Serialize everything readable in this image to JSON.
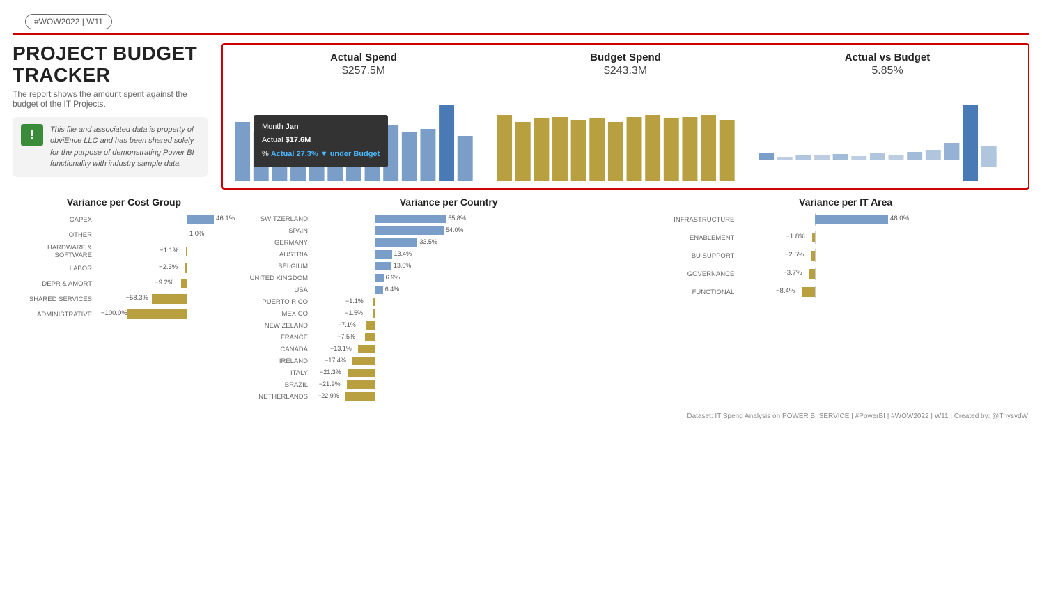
{
  "header": {
    "tag": "#WOW2022 | W11"
  },
  "project": {
    "title": "PROJECT BUDGET TRACKER",
    "subtitle": "The report shows the amount spent against the budget of the IT Projects.",
    "notice": "This file and associated data is property of obviEnce LLC and has been shared solely for the purpose of demonstrating Power BI functionality with industry sample data."
  },
  "kpi": {
    "actual_spend_label": "Actual Spend",
    "actual_spend_value": "$257.5M",
    "budget_spend_label": "Budget Spend",
    "budget_spend_value": "$243.3M",
    "actual_vs_budget_label": "Actual vs Budget",
    "actual_vs_budget_value": "5.85%",
    "tooltip": {
      "month_label": "Month",
      "month_value": "Jan",
      "actual_label": "Actual",
      "actual_value": "$17.6M",
      "pct_label": "%",
      "pct_value": "Actual 27.3% ▼ under Budget"
    }
  },
  "variance_cost_group": {
    "title": "Variance per Cost Group",
    "items": [
      {
        "label": "CAPEX",
        "value": 46.1,
        "display": "46.1%"
      },
      {
        "label": "OTHER",
        "value": 1.0,
        "display": "1.0%"
      },
      {
        "label": "HARDWARE & SOFTWARE",
        "value": -1.1,
        "display": "−1.1%"
      },
      {
        "label": "LABOR",
        "value": -2.3,
        "display": "−2.3%"
      },
      {
        "label": "DEPR & AMORT",
        "value": -9.2,
        "display": "−9.2%"
      },
      {
        "label": "SHARED SERVICES",
        "value": -58.3,
        "display": "−58.3%"
      },
      {
        "label": "ADMINISTRATIVE",
        "value": -100.0,
        "display": "−100.0%"
      }
    ]
  },
  "variance_country": {
    "title": "Variance per Country",
    "items": [
      {
        "label": "SWITZERLAND",
        "value": 55.8,
        "display": "55.8%"
      },
      {
        "label": "SPAIN",
        "value": 54.0,
        "display": "54.0%"
      },
      {
        "label": "GERMANY",
        "value": 33.5,
        "display": "33.5%"
      },
      {
        "label": "AUSTRIA",
        "value": 13.4,
        "display": "13.4%"
      },
      {
        "label": "BELGIUM",
        "value": 13.0,
        "display": "13.0%"
      },
      {
        "label": "UNITED KINGDOM",
        "value": 6.9,
        "display": "6.9%"
      },
      {
        "label": "USA",
        "value": 6.4,
        "display": "6.4%"
      },
      {
        "label": "PUERTO RICO",
        "value": -1.1,
        "display": "−1.1%"
      },
      {
        "label": "MEXICO",
        "value": -1.5,
        "display": "−1.5%"
      },
      {
        "label": "NEW ZELAND",
        "value": -7.1,
        "display": "−7.1%"
      },
      {
        "label": "FRANCE",
        "value": -7.5,
        "display": "−7.5%"
      },
      {
        "label": "CANADA",
        "value": -13.1,
        "display": "−13.1%"
      },
      {
        "label": "IRELAND",
        "value": -17.4,
        "display": "−17.4%"
      },
      {
        "label": "ITALY",
        "value": -21.3,
        "display": "−21.3%"
      },
      {
        "label": "BRAZIL",
        "value": -21.9,
        "display": "−21.9%"
      },
      {
        "label": "NETHERLANDS",
        "value": -22.9,
        "display": "−22.9%"
      }
    ]
  },
  "variance_it_area": {
    "title": "Variance per IT Area",
    "items": [
      {
        "label": "INFRASTRUCTURE",
        "value": 48.0,
        "display": "48.0%"
      },
      {
        "label": "ENABLEMENT",
        "value": -1.8,
        "display": "−1.8%"
      },
      {
        "label": "BU SUPPORT",
        "value": -2.5,
        "display": "−2.5%"
      },
      {
        "label": "GOVERNANCE",
        "value": -3.7,
        "display": "−3.7%"
      },
      {
        "label": "FUNCTIONAL",
        "value": -8.4,
        "display": "−8.4%"
      }
    ]
  },
  "footer": "Dataset: IT Spend Analysis on POWER BI SERVICE | #PowerBI | #WOW2022 | W11 | Created by: @ThysvdW"
}
